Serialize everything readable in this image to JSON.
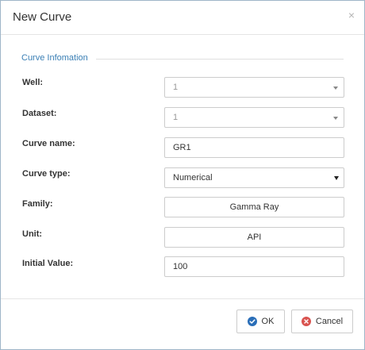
{
  "dialog": {
    "title": "New Curve",
    "close_glyph": "×"
  },
  "section": {
    "legend": "Curve Infomation"
  },
  "fields": {
    "well": {
      "label": "Well:",
      "value": "1"
    },
    "dataset": {
      "label": "Dataset:",
      "value": "1"
    },
    "curve_name": {
      "label": "Curve name:",
      "value": "GR1"
    },
    "curve_type": {
      "label": "Curve type:",
      "value": "Numerical"
    },
    "family": {
      "label": "Family:",
      "value": "Gamma Ray"
    },
    "unit": {
      "label": "Unit:",
      "value": "API"
    },
    "initial_value": {
      "label": "Initial Value:",
      "value": "100"
    }
  },
  "footer": {
    "ok_label": "OK",
    "cancel_label": "Cancel"
  },
  "colors": {
    "accent": "#3a7fb5",
    "ok_icon": "#2a6eb8",
    "cancel_icon": "#d9534f"
  },
  "icons": {
    "ok": "check-circle-icon",
    "cancel": "times-circle-icon",
    "close": "close-icon"
  }
}
